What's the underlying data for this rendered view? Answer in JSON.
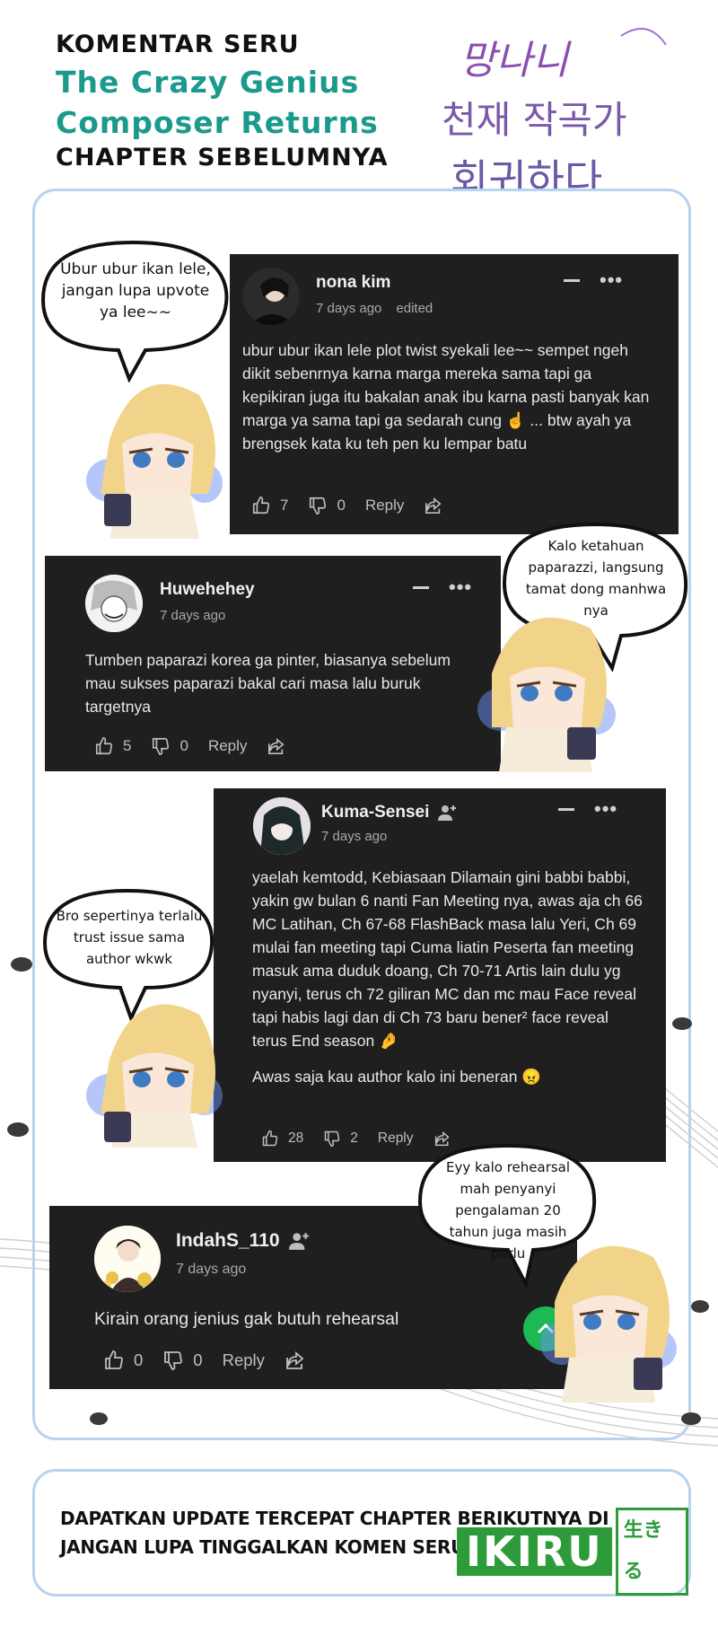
{
  "header": {
    "line1": "KOMENTAR SERU",
    "line2": "The Crazy Genius",
    "line3": "Composer Returns",
    "line4": "CHAPTER SEBELUMNYA",
    "logo_text": [
      "망나니",
      "천재 작곡가",
      "회귀하다"
    ]
  },
  "comments": [
    {
      "user": "nona kim",
      "time": "7 days ago",
      "edited": "edited",
      "paragraphs": [
        "ubur ubur ikan lele plot twist syekali lee~~ sempet ngeh dikit sebenrnya karna marga mereka sama tapi ga kepikiran juga itu bakalan anak ibu karna pasti banyak kan marga ya sama tapi ga sedarah cung ☝️ ... btw ayah ya brengsek kata ku teh pen ku lempar batu"
      ],
      "likes": "7",
      "dislikes": "0",
      "reply": "Reply"
    },
    {
      "user": "Huwehehey",
      "time": "7 days ago",
      "paragraphs": [
        "Tumben paparazi korea ga pinter, biasanya sebelum mau sukses paparazi bakal cari masa lalu buruk targetnya"
      ],
      "likes": "5",
      "dislikes": "0",
      "reply": "Reply"
    },
    {
      "user": "Kuma-Sensei",
      "time": "7 days ago",
      "paragraphs": [
        "yaelah kemtodd, Kebiasaan Dilamain gini babbi babbi,\nyakin gw bulan 6 nanti Fan Meeting nya, awas aja ch 66 MC Latihan, Ch 67-68 FlashBack masa lalu Yeri, Ch 69 mulai fan meeting tapi Cuma liatin Peserta fan meeting masuk ama duduk doang, Ch 70-71 Artis lain dulu yg nyanyi, terus ch 72 giliran MC dan mc mau Face reveal tapi habis lagi dan di Ch 73 baru bener² face reveal terus End season 🤌",
        "Awas saja kau author kalo ini beneran 😠"
      ],
      "likes": "28",
      "dislikes": "2",
      "reply": "Reply"
    },
    {
      "user": "IndahS_110",
      "time": "7 days ago",
      "paragraphs": [
        "Kirain orang jenius gak butuh rehearsal"
      ],
      "likes": "0",
      "dislikes": "0",
      "reply": "Reply"
    }
  ],
  "bubbles": [
    "Ubur ubur ikan lele, jangan lupa upvote ya lee~~",
    "Kalo ketahuan paparazzi, langsung tamat dong manhwa nya",
    "Bro sepertinya terlalu trust issue sama author wkwk",
    "Eyy kalo rehearsal mah penyanyi pengalaman 20 tahun juga masih perlu"
  ],
  "footer": {
    "line1": "DAPATKAN UPDATE TERCEPAT CHAPTER BERIKUTNYA DI",
    "line2": "JANGAN LUPA TINGGALKAN KOMEN SERU BIAR DI NOTIS",
    "brand": "IKIRU",
    "brand_jp": "生きる"
  },
  "colors": {
    "accent": "#1b9a8c",
    "card": "#1f1f1f",
    "frame": "#b7d3ee",
    "brand": "#2e9b3a"
  }
}
